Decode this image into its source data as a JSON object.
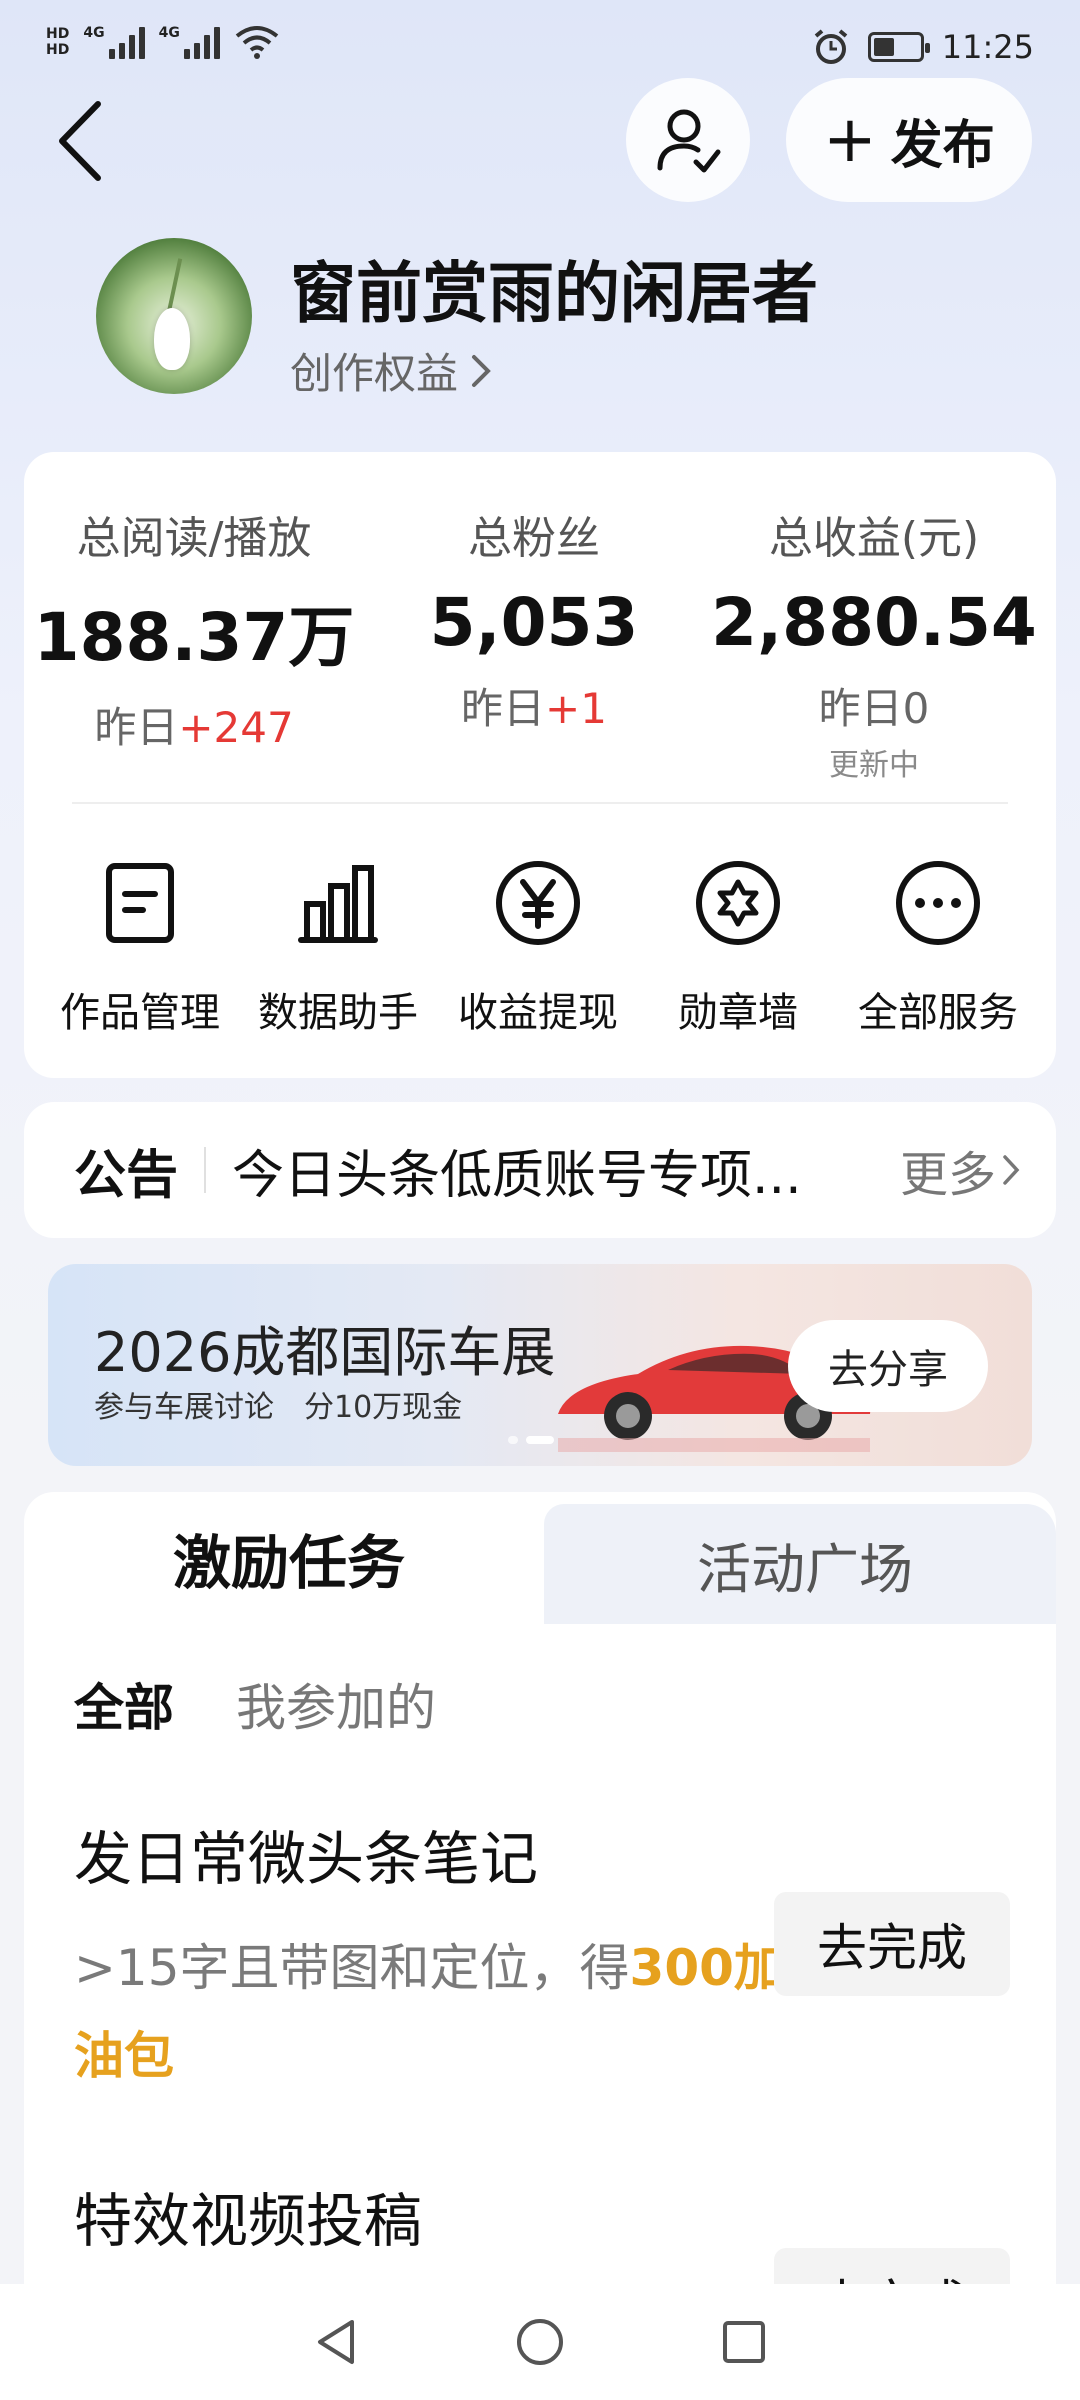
{
  "status_bar": {
    "left_labels": [
      "HD",
      "HD"
    ],
    "network": [
      "4G",
      "4G"
    ],
    "time": "11:25"
  },
  "header": {
    "publish_label": "发布"
  },
  "profile": {
    "name": "窗前赏雨的闲居者",
    "creator_rights": "创作权益"
  },
  "stats": [
    {
      "label": "总阅读/播放",
      "value": "188.37万",
      "delta_prefix": "昨日",
      "delta": "+247",
      "note": ""
    },
    {
      "label": "总粉丝",
      "value": "5,053",
      "delta_prefix": "昨日",
      "delta": "+1",
      "note": ""
    },
    {
      "label": "总收益(元)",
      "value": "2,880.54",
      "delta_prefix": "昨日0",
      "delta": "",
      "note": "更新中"
    }
  ],
  "tools": [
    {
      "label": "作品管理",
      "icon": "document-icon"
    },
    {
      "label": "数据助手",
      "icon": "bar-chart-icon"
    },
    {
      "label": "收益提现",
      "icon": "yen-icon"
    },
    {
      "label": "勋章墙",
      "icon": "badge-icon"
    },
    {
      "label": "全部服务",
      "icon": "more-icon"
    }
  ],
  "notice": {
    "title": "公告",
    "text": "今日头条低质账号专项...",
    "more": "更多"
  },
  "banner": {
    "title": "2026成都国际车展",
    "subtitle": "参与车展讨论　分10万现金",
    "button": "去分享",
    "slide_index": 2,
    "slide_count": 2
  },
  "tasks": {
    "tabs": [
      "激励任务",
      "活动广场"
    ],
    "filters": [
      "全部",
      "我参加的"
    ],
    "items": [
      {
        "title": "发日常微头条笔记",
        "desc_plain": ">15字且带图和定位，得",
        "desc_highlight": "300",
        "desc_tail": "加油包",
        "button": "去完成"
      },
      {
        "title": "特效视频投稿",
        "button": "去完成"
      }
    ]
  },
  "nav": [
    "back-nav-icon",
    "home-nav-icon",
    "recents-nav-icon"
  ],
  "colors": {
    "accent_red": "#e53935",
    "highlight_orange": "#e6a11e"
  }
}
